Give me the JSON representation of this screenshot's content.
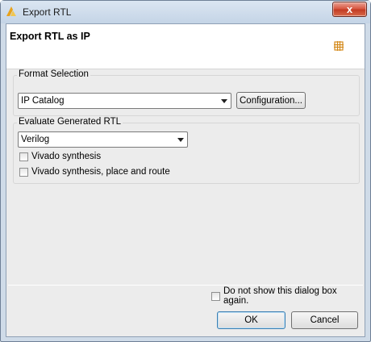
{
  "window": {
    "title": "Export RTL",
    "close_symbol": "x"
  },
  "header": {
    "title": "Export RTL as IP",
    "icon": "ip-grid-icon"
  },
  "format_selection": {
    "label": "Format Selection",
    "format_value": "IP Catalog",
    "configuration_button": "Configuration..."
  },
  "evaluate_rtl": {
    "label": "Evaluate Generated RTL",
    "language_value": "Verilog",
    "options": [
      {
        "label": "Vivado synthesis",
        "checked": false
      },
      {
        "label": "Vivado synthesis, place and route",
        "checked": false
      }
    ]
  },
  "footer": {
    "dont_show_label": "Do not show this dialog box again.",
    "dont_show_checked": false,
    "ok_label": "OK",
    "cancel_label": "Cancel"
  },
  "colors": {
    "accent_icon": "#d48a1c",
    "title_bar": "#c4d4e6",
    "close_button": "#c23a22"
  }
}
